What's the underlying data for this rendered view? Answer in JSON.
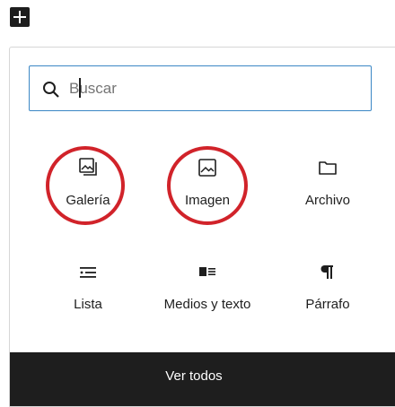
{
  "inserter": {
    "search": {
      "placeholder": "Buscar",
      "value": ""
    },
    "blocks": [
      {
        "label": "Galería",
        "icon": "gallery-icon",
        "highlighted": true
      },
      {
        "label": "Imagen",
        "icon": "image-icon",
        "highlighted": true
      },
      {
        "label": "Archivo",
        "icon": "folder-icon",
        "highlighted": false
      },
      {
        "label": "Lista",
        "icon": "list-icon",
        "highlighted": false
      },
      {
        "label": "Medios y texto",
        "icon": "media-text-icon",
        "highlighted": false
      },
      {
        "label": "Párrafo",
        "icon": "paragraph-icon",
        "highlighted": false
      }
    ],
    "browse_all_label": "Ver todos"
  },
  "colors": {
    "highlight": "#d1232a",
    "focus": "#3b87c5",
    "dark": "#1e1e1e"
  }
}
